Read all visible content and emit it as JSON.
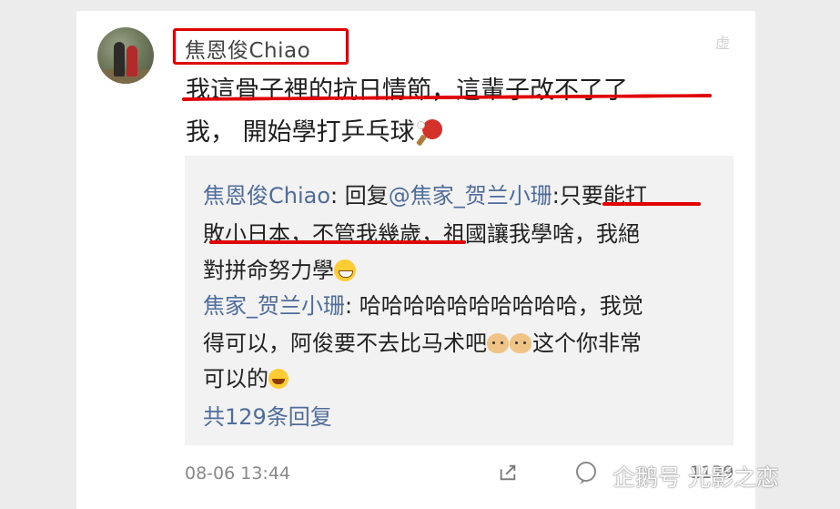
{
  "post": {
    "username": "焦恩俊Chiao",
    "brand_mark": "虚",
    "content_line1": "我這骨子裡的抗日情節，這輩子改不了了",
    "content_line2": "我， 開始學打乒乓球"
  },
  "reply_thread": {
    "r1_user": "焦恩俊Chiao",
    "r1_sep": ": 回复",
    "r1_mention": "@焦家_贺兰小珊",
    "r1_text": ":只要能打",
    "r2_text": "敗小日本，不管我幾歲，祖國讓我學啥，我絕",
    "r3_text": "對拼命努力學",
    "r4_user": "焦家_贺兰小珊",
    "r4_text": ": 哈哈哈哈哈哈哈哈哈哈，我觉",
    "r5_text_a": "得可以，阿俊要不去比马术吧",
    "r5_text_b": "这个你非常",
    "r6_text": "可以的",
    "reply_count": "共129条回复"
  },
  "footer": {
    "timestamp": "08-06 13:44",
    "likes": "1139",
    "watermark": "企鹅号 光影之恋"
  },
  "icons": {
    "share": "share-icon",
    "comment": "comment-icon"
  },
  "colors": {
    "annotation_red": "#e00000",
    "link_blue": "#4f6c9a"
  }
}
